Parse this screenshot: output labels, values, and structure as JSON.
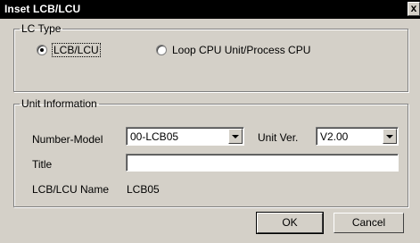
{
  "window": {
    "title": "Inset LCB/LCU",
    "close_glyph": "x"
  },
  "lc_type": {
    "legend": "LC Type",
    "options": [
      {
        "label": "LCB/LCU",
        "selected": true
      },
      {
        "label": "Loop CPU Unit/Process CPU",
        "selected": false
      }
    ]
  },
  "unit_info": {
    "legend": "Unit Information",
    "number_model_label": "Number-Model",
    "number_model_value": "00-LCB05",
    "unit_ver_label": "Unit Ver.",
    "unit_ver_value": "V2.00",
    "title_label": "Title",
    "title_value": "",
    "name_label": "LCB/LCU Name",
    "name_value": "LCB05"
  },
  "buttons": {
    "ok": "OK",
    "cancel": "Cancel"
  },
  "colors": {
    "titlebar": "#000000",
    "face": "#d4d0c8"
  }
}
